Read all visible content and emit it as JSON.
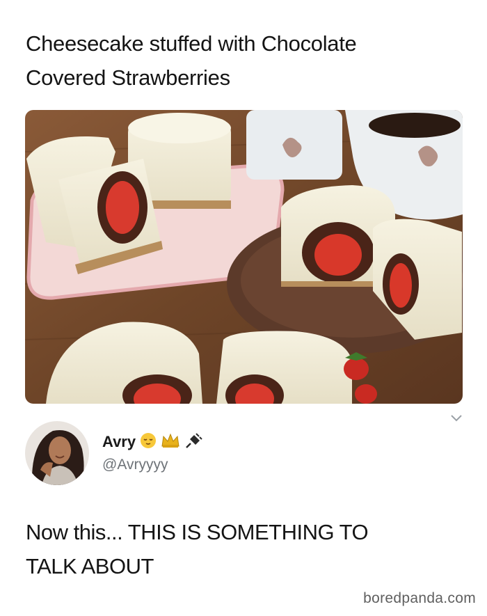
{
  "post": {
    "caption": "Cheesecake stuffed with Chocolate\nCovered Strawberries",
    "image_alt_icon": "cheesecake-photo"
  },
  "tweet": {
    "display_name": "Avry",
    "name_emojis": [
      "relieved-face-icon",
      "crown-icon",
      "plug-icon"
    ],
    "handle": "@Avryyyy",
    "text": "Now this... THIS IS SOMETHING TO\nTALK ABOUT",
    "expand_icon": "chevron-down-icon"
  },
  "watermark": "boredpanda.com",
  "colors": {
    "text": "#141414",
    "handle": "#6e7378",
    "watermark": "#5f5f5f",
    "background": "#ffffff"
  }
}
